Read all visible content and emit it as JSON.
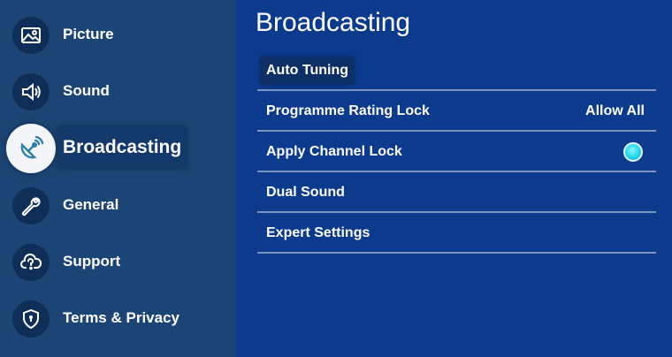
{
  "sidebar": {
    "items": [
      {
        "label": "Picture",
        "icon": "picture-icon"
      },
      {
        "label": "Sound",
        "icon": "speaker-icon"
      },
      {
        "label": "Broadcasting",
        "icon": "satellite-dish-icon",
        "active": true
      },
      {
        "label": "General",
        "icon": "wrench-icon"
      },
      {
        "label": "Support",
        "icon": "cloud-question-icon"
      },
      {
        "label": "Terms & Privacy",
        "icon": "shield-lock-icon"
      }
    ]
  },
  "main": {
    "title": "Broadcasting",
    "items": [
      {
        "label": "Auto Tuning",
        "value": "",
        "focused": true
      },
      {
        "label": "Programme Rating Lock",
        "value": "Allow All"
      },
      {
        "label": "Apply Channel Lock",
        "value": "",
        "toggle": "on"
      },
      {
        "label": "Dual Sound",
        "value": ""
      },
      {
        "label": "Expert Settings",
        "value": ""
      }
    ]
  },
  "colors": {
    "sidebar_bg": "#1c4575",
    "main_bg": "#0c3a8c",
    "toggle_on": "#1fd6f0"
  }
}
